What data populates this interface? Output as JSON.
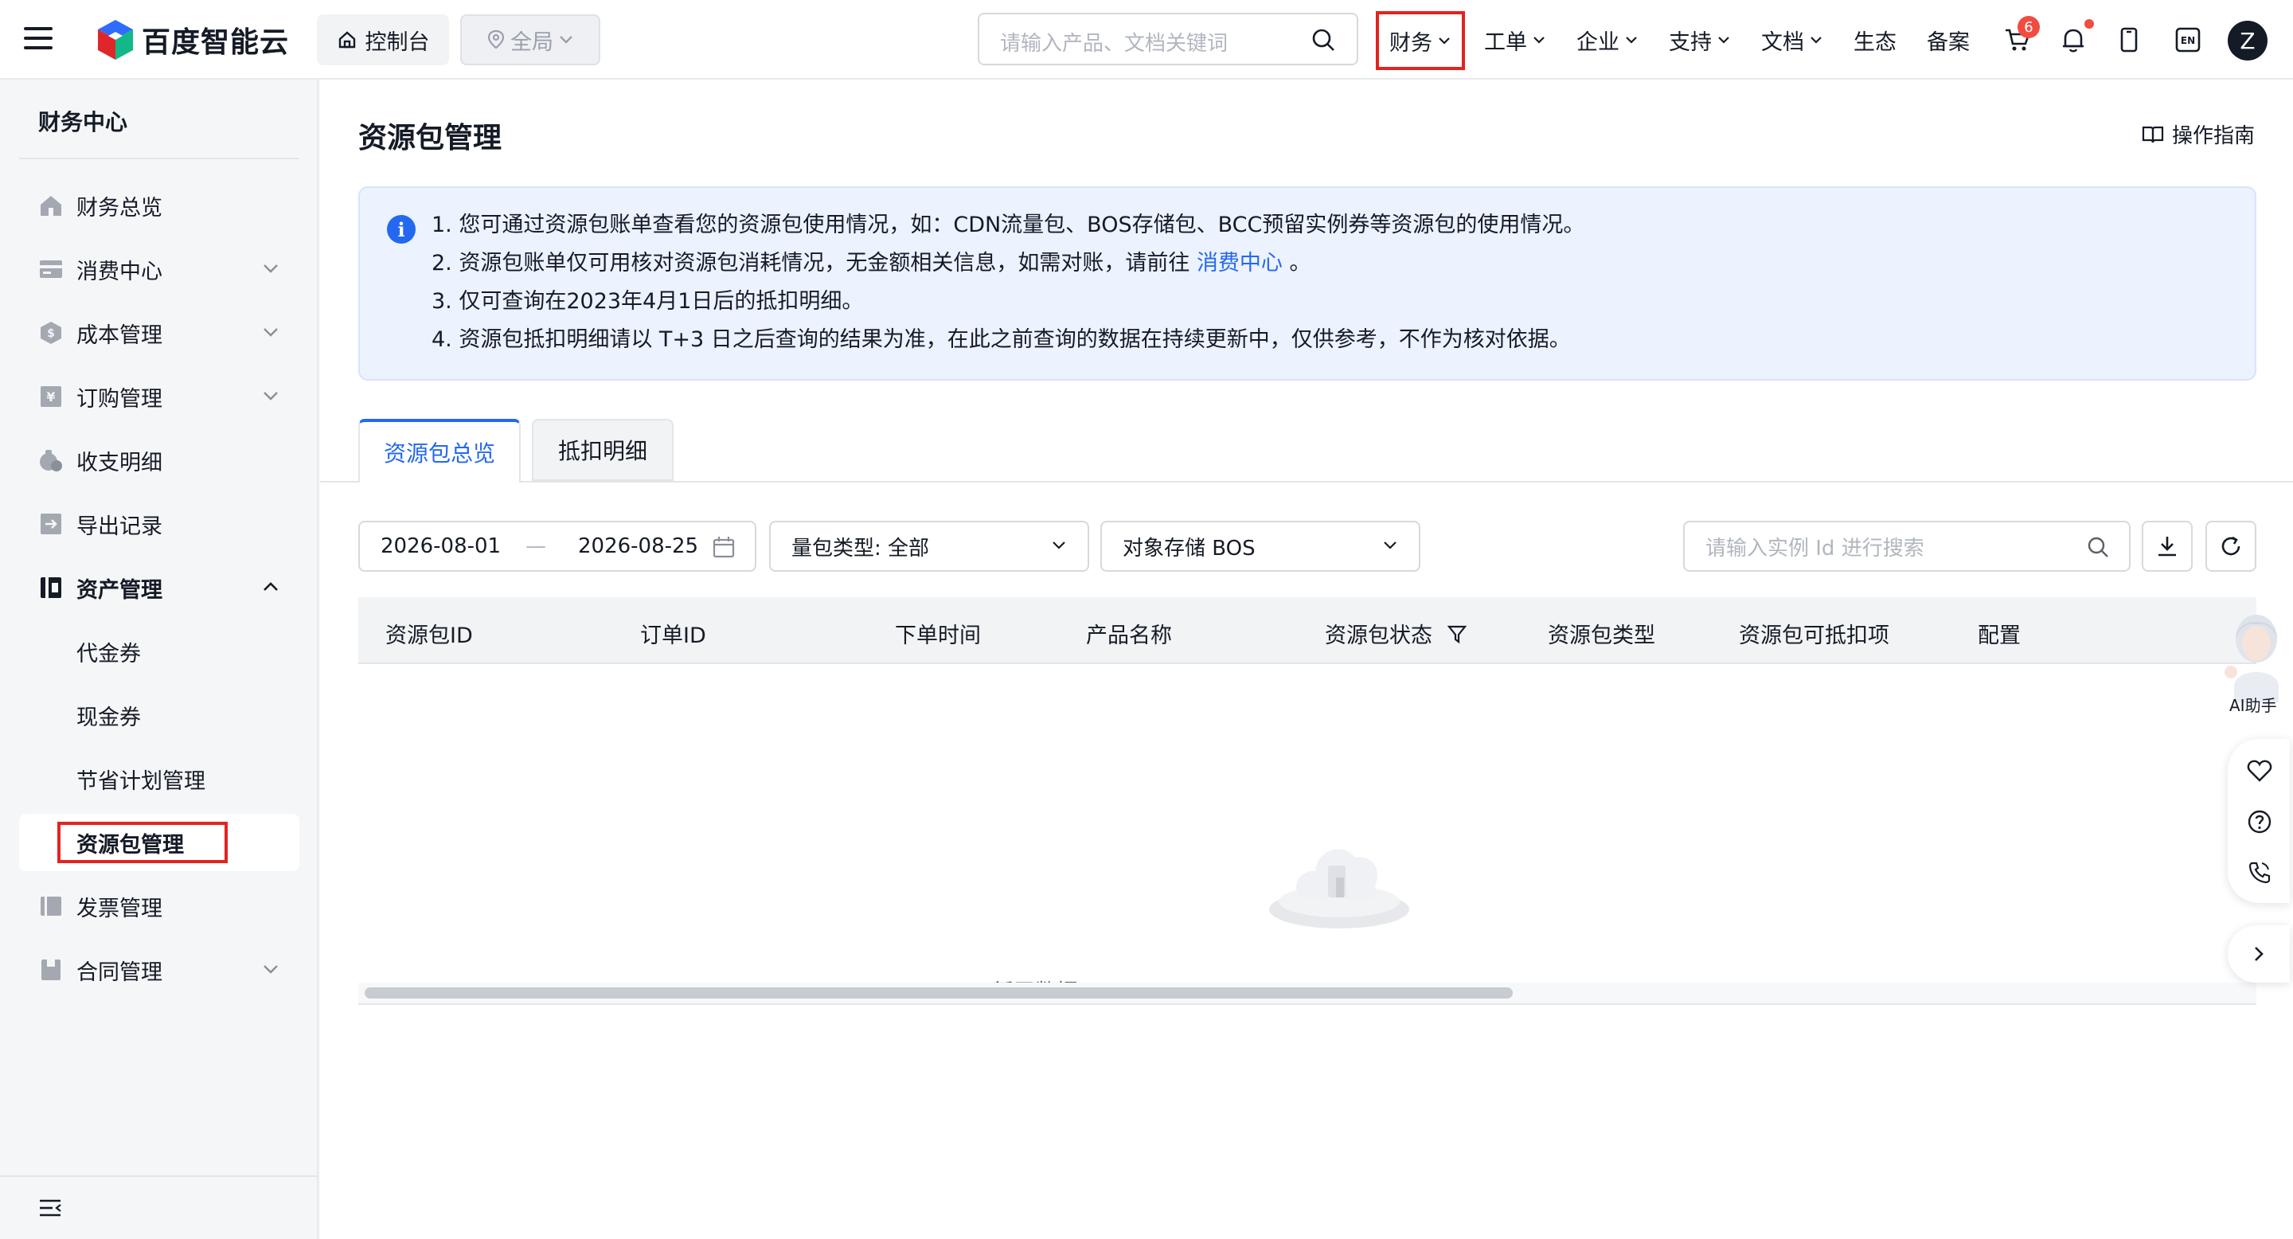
{
  "topbar": {
    "brand": "百度智能云",
    "console_label": "控制台",
    "region_label": "全局",
    "search_placeholder": "请输入产品、文档关键词",
    "nav": {
      "finance": "财务",
      "ticket": "工单",
      "enterprise": "企业",
      "support": "支持",
      "docs": "文档",
      "ecosystem": "生态",
      "filing": "备案"
    },
    "cart_badge": "6",
    "lang": "EN",
    "avatar_letter": "Z"
  },
  "sidebar": {
    "title": "财务中心",
    "items": [
      {
        "label": "财务总览",
        "icon": "home-icon"
      },
      {
        "label": "消费中心",
        "icon": "card-icon"
      },
      {
        "label": "成本管理",
        "icon": "cost-icon"
      },
      {
        "label": "订购管理",
        "icon": "yen-icon"
      },
      {
        "label": "收支明细",
        "icon": "money-bag-icon"
      },
      {
        "label": "导出记录",
        "icon": "export-icon"
      },
      {
        "label": "资产管理",
        "icon": "asset-icon"
      },
      {
        "label": "发票管理",
        "icon": "invoice-icon"
      },
      {
        "label": "合同管理",
        "icon": "contract-icon"
      }
    ],
    "asset_sub": [
      "代金券",
      "现金券",
      "节省计划管理",
      "资源包管理"
    ]
  },
  "page": {
    "title": "资源包管理",
    "guide_label": "操作指南",
    "notice": {
      "line1": "1. 您可通过资源包账单查看您的资源包使用情况，如：CDN流量包、BOS存储包、BCC预留实例券等资源包的使用情况。",
      "line2_prefix": "2. 资源包账单仅可用核对资源包消耗情况，无金额相关信息，如需对账，请前往",
      "line2_link": "消费中心",
      "line2_suffix": "。",
      "line3": "3. 仅可查询在2023年4月1日后的抵扣明细。",
      "line4": "4. 资源包抵扣明细请以 T+3 日之后查询的结果为准，在此之前查询的数据在持续更新中，仅供参考，不作为核对依据。"
    },
    "tabs": [
      "资源包总览",
      "抵扣明细"
    ],
    "filters": {
      "date_start": "2026-08-01",
      "date_sep": "—",
      "date_end": "2026-08-25",
      "package_type": "量包类型: 全部",
      "product": "对象存储 BOS",
      "instance_search_placeholder": "请输入实例 Id 进行搜索"
    },
    "table": {
      "columns": [
        "资源包ID",
        "订单ID",
        "下单时间",
        "产品名称",
        "资源包状态",
        "资源包类型",
        "资源包可抵扣项",
        "配置"
      ],
      "rows": [],
      "empty_text": "暂无数据"
    }
  },
  "floating": {
    "ai_label": "AI助手"
  },
  "colors": {
    "accent": "#2468f2",
    "highlight_frame": "#e5221f",
    "notice_bg": "#ecf2fe"
  }
}
